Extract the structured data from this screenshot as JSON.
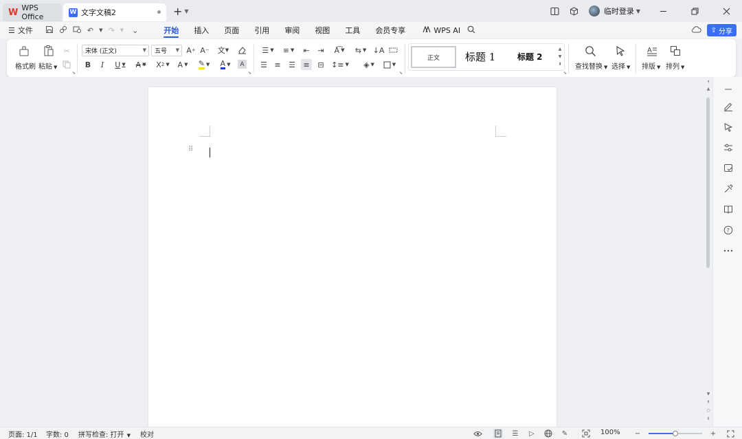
{
  "titlebar": {
    "tabs": [
      {
        "label": "WPS Office",
        "icon": "wps-logo-icon"
      },
      {
        "label": "文字文稿2",
        "icon": "wps-writer-icon"
      }
    ],
    "logo_letter": "W",
    "login_label": "临时登录"
  },
  "menubar": {
    "file_label": "文件",
    "tabs": [
      "开始",
      "插入",
      "页面",
      "引用",
      "审阅",
      "视图",
      "工具",
      "会员专享"
    ],
    "active_tab": "开始",
    "wps_ai_label": "WPS AI",
    "share_label": "分享"
  },
  "ribbon": {
    "format_painter": "格式刷",
    "paste": "粘贴",
    "font_name": "宋体 (正文)",
    "font_size": "五号",
    "styles": {
      "normal": "正文",
      "heading1": "标题  1",
      "heading2": "标题  2"
    },
    "find_replace": "查找替换",
    "select": "选择",
    "layout": "排版",
    "arrange": "排列",
    "colors": {
      "highlight": "#f5e61c",
      "font_color": "#1f3fd1"
    }
  },
  "statusbar": {
    "page": "页面: 1/1",
    "words": "字数: 0",
    "spellcheck": "拼写检查: 打开",
    "proofread": "校对",
    "zoom": "100%",
    "zoom_level": 0.5
  },
  "colors": {
    "accent": "#2a5bd7",
    "share_button": "#3a6ff2",
    "wps_red": "#e8342b"
  }
}
